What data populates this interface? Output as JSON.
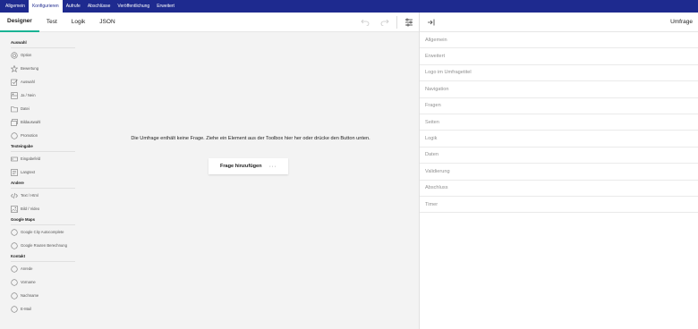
{
  "topnav": {
    "tabs": [
      {
        "label": "Allgemein"
      },
      {
        "label": "Konfigurieren"
      },
      {
        "label": "Aufrufe"
      },
      {
        "label": "Abschlüsse"
      },
      {
        "label": "Veröffentlichung"
      },
      {
        "label": "Erweitert"
      }
    ],
    "active_index": 1
  },
  "subbar": {
    "tabs": [
      {
        "label": "Designer"
      },
      {
        "label": "Test"
      },
      {
        "label": "Logik"
      },
      {
        "label": "JSON"
      }
    ],
    "active_index": 0,
    "tools": [
      "undo-icon",
      "redo-icon",
      "settings-icon"
    ]
  },
  "toolbox": {
    "groups": [
      {
        "title": "Auswahl",
        "items": [
          {
            "label": "Option",
            "icon": "radio-icon"
          },
          {
            "label": "Bewertung",
            "icon": "star-icon"
          },
          {
            "label": "Auswahl",
            "icon": "checkbox-icon"
          },
          {
            "label": "Ja / Nein",
            "icon": "boolean-icon"
          },
          {
            "label": "Datei",
            "icon": "folder-icon"
          },
          {
            "label": "Bildauswahl",
            "icon": "image-picker-icon"
          },
          {
            "label": "Promotion",
            "icon": "circle-icon"
          }
        ]
      },
      {
        "title": "Texteingabe",
        "items": [
          {
            "label": "Eingabefeld",
            "icon": "input-icon"
          },
          {
            "label": "Langtext",
            "icon": "textarea-icon"
          }
        ]
      },
      {
        "title": "Andere",
        "items": [
          {
            "label": "Text / Html",
            "icon": "code-icon"
          },
          {
            "label": "Bild / Video",
            "icon": "image-icon"
          }
        ]
      },
      {
        "title": "Google Maps",
        "items": [
          {
            "label": "Google City Autocomplete",
            "icon": "circle-icon"
          },
          {
            "label": "Google Routen Berechnung",
            "icon": "circle-icon"
          }
        ]
      },
      {
        "title": "Kontakt",
        "items": [
          {
            "label": "Anrede",
            "icon": "circle-icon"
          },
          {
            "label": "Vorname",
            "icon": "circle-icon"
          },
          {
            "label": "Nachname",
            "icon": "circle-icon"
          },
          {
            "label": "E-Mail",
            "icon": "circle-icon"
          }
        ]
      }
    ]
  },
  "canvas": {
    "empty_message": "Die Umfrage enthält keine Frage. Ziehe ein Element aus der Toolbox hier her oder drücke den Button unten.",
    "add_question_label": "Frage hinzufügen",
    "more_label": "···"
  },
  "properties": {
    "title": "Umfrage",
    "sections": [
      {
        "label": "Allgemein"
      },
      {
        "label": "Erweitert"
      },
      {
        "label": "Logo im Umfragetitel"
      },
      {
        "label": "Navigation"
      },
      {
        "label": "Fragen"
      },
      {
        "label": "Seiten"
      },
      {
        "label": "Logik"
      },
      {
        "label": "Daten"
      },
      {
        "label": "Validierung"
      },
      {
        "label": "Abschluss"
      },
      {
        "label": "Timer"
      }
    ]
  },
  "colors": {
    "topnav_bg": "#1e2a8f",
    "accent": "#19b394",
    "canvas_bg": "#f3f3f3",
    "icon_gray": "#888888"
  }
}
